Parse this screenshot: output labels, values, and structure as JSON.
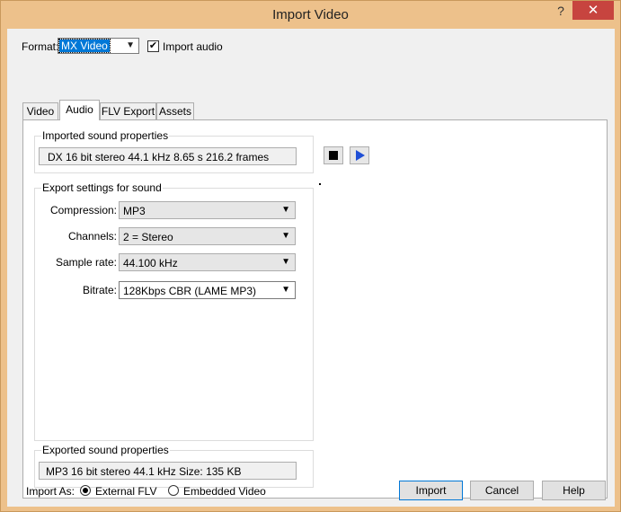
{
  "window": {
    "title": "Import Video",
    "help": "?",
    "close": "✕"
  },
  "format": {
    "label": "Format:",
    "value": "MX Video"
  },
  "import_audio": {
    "label": "Import audio",
    "checked": true
  },
  "tabs": [
    {
      "label": "Video"
    },
    {
      "label": "Audio"
    },
    {
      "label": "FLV Export"
    },
    {
      "label": "Assets"
    }
  ],
  "imported": {
    "title": "Imported sound properties",
    "value": "DX 16 bit stereo  44.1 kHz 8.65 s 216.2 frames"
  },
  "export_settings": {
    "title": "Export settings for sound",
    "rows": [
      {
        "label": "Compression:",
        "value": "MP3"
      },
      {
        "label": "Channels:",
        "value": "2 = Stereo"
      },
      {
        "label": "Sample rate:",
        "value": "44.100 kHz"
      },
      {
        "label": "Bitrate:",
        "value": "128Kbps CBR (LAME MP3)"
      }
    ]
  },
  "exported": {
    "title": "Exported sound properties",
    "value": "MP3 16 bit stereo  44.1 kHz Size: 135 KB"
  },
  "import_as": {
    "label": "Import As:",
    "options": [
      {
        "label": "External FLV",
        "selected": true
      },
      {
        "label": "Embedded Video",
        "selected": false
      }
    ]
  },
  "buttons": {
    "import": "Import",
    "cancel": "Cancel",
    "help": "Help"
  }
}
